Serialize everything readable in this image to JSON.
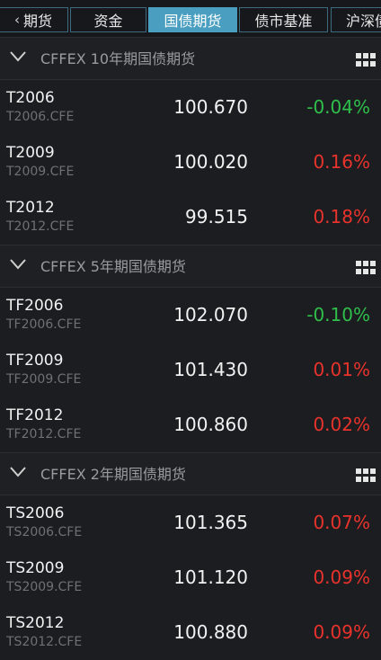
{
  "tabs": [
    {
      "label": "期货",
      "back": "‹"
    },
    {
      "label": "资金"
    },
    {
      "label": "国债期货",
      "active": true
    },
    {
      "label": "债市基准"
    },
    {
      "label": "沪深债"
    }
  ],
  "sections": [
    {
      "title": "CFFEX 10年期国债期货",
      "rows": [
        {
          "name": "T2006",
          "code": "T2006.CFE",
          "price": "100.670",
          "change": "-0.04%",
          "dir": "down"
        },
        {
          "name": "T2009",
          "code": "T2009.CFE",
          "price": "100.020",
          "change": "0.16%",
          "dir": "up"
        },
        {
          "name": "T2012",
          "code": "T2012.CFE",
          "price": "99.515",
          "change": "0.18%",
          "dir": "up"
        }
      ]
    },
    {
      "title": "CFFEX 5年期国债期货",
      "rows": [
        {
          "name": "TF2006",
          "code": "TF2006.CFE",
          "price": "102.070",
          "change": "-0.10%",
          "dir": "down"
        },
        {
          "name": "TF2009",
          "code": "TF2009.CFE",
          "price": "101.430",
          "change": "0.01%",
          "dir": "up"
        },
        {
          "name": "TF2012",
          "code": "TF2012.CFE",
          "price": "100.860",
          "change": "0.02%",
          "dir": "up"
        }
      ]
    },
    {
      "title": "CFFEX 2年期国债期货",
      "rows": [
        {
          "name": "TS2006",
          "code": "TS2006.CFE",
          "price": "101.365",
          "change": "0.07%",
          "dir": "up"
        },
        {
          "name": "TS2009",
          "code": "TS2009.CFE",
          "price": "101.120",
          "change": "0.09%",
          "dir": "up"
        },
        {
          "name": "TS2012",
          "code": "TS2012.CFE",
          "price": "100.880",
          "change": "0.09%",
          "dir": "up"
        }
      ]
    }
  ],
  "colors": {
    "up": "#e8322c",
    "down": "#2fbf4a",
    "active_tab": "#4a9fc0",
    "background": "#1c1d20"
  },
  "icons": {
    "section_toggle": "chevron-down-icon",
    "section_menu": "grid-icon"
  }
}
